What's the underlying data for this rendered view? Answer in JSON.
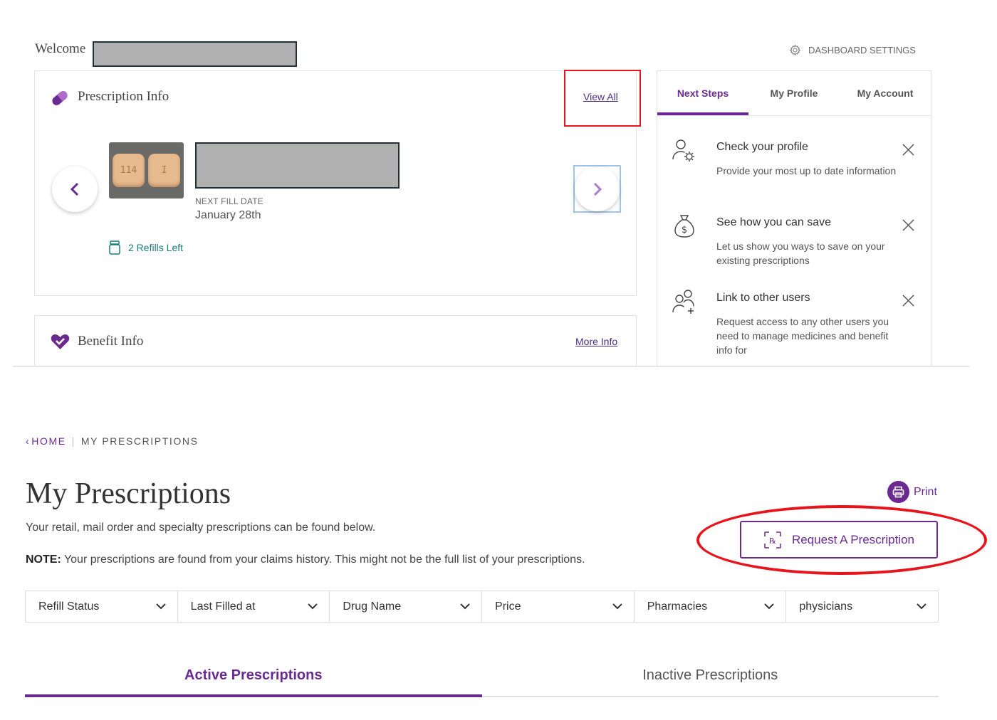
{
  "dashboard": {
    "welcome": "Welcome",
    "settings_label": "DASHBOARD SETTINGS",
    "prescription_card": {
      "title": "Prescription Info",
      "view_all": "View All",
      "pill_markings": [
        "114",
        "I"
      ],
      "next_fill_label": "NEXT FILL DATE",
      "next_fill_date": "January 28th",
      "refills": "2 Refills Left"
    },
    "benefit_card": {
      "title": "Benefit Info",
      "more_info": "More Info"
    },
    "side_tabs": [
      "Next Steps",
      "My Profile",
      "My Account"
    ],
    "steps": [
      {
        "title": "Check your profile",
        "desc": "Provide your most up to date information",
        "icon": "profile-settings-icon"
      },
      {
        "title": "See how you can save",
        "desc": "Let us show you ways to save on your existing prescriptions",
        "icon": "money-bag-icon"
      },
      {
        "title": "Link to other users",
        "desc": "Request access to any other users you need to manage medicines and benefit info for",
        "icon": "add-users-icon"
      }
    ]
  },
  "prescriptions_page": {
    "breadcrumb": {
      "home": "HOME",
      "current": "MY PRESCRIPTIONS"
    },
    "title": "My Prescriptions",
    "subtitle": "Your retail, mail order and specialty prescriptions can be found below.",
    "note_label": "NOTE:",
    "note_text": " Your prescriptions are found from your claims history. This might not be the full list of your prescriptions.",
    "print_label": "Print",
    "request_button": "Request A Prescription",
    "filters": [
      "Refill Status",
      "Last Filled at",
      "Drug Name",
      "Price",
      "Pharmacies",
      "physicians"
    ],
    "tabs": [
      "Active Prescriptions",
      "Inactive Prescriptions"
    ]
  },
  "colors": {
    "brand_purple": "#6b2a90",
    "annotation_red": "#e8141c",
    "refill_teal": "#1a7a7a"
  }
}
